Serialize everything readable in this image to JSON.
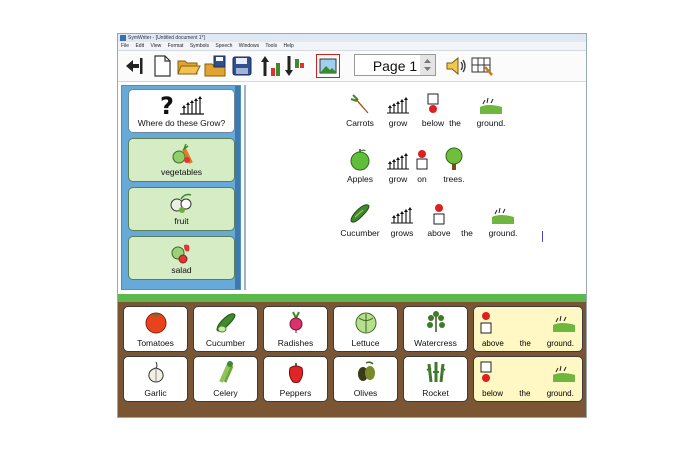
{
  "window": {
    "title": "SymWriter - [Untitled document 1*]"
  },
  "menu": [
    "File",
    "Edit",
    "View",
    "Format",
    "Symbols",
    "Speech",
    "Windows",
    "Tools",
    "Help"
  ],
  "toolbar": {
    "page_label": "Page 1",
    "buttons": [
      "back-icon",
      "new-document-icon",
      "open-folder-icon",
      "save-to-folder-icon",
      "save-disk-icon",
      "sort-ascending-icon",
      "sort-descending-icon",
      "picture-icon",
      "speaker-icon",
      "grid-edit-icon"
    ]
  },
  "left_grid": [
    {
      "label": "Where do these Grow?",
      "symbol": "question-mark-grow"
    },
    {
      "label": "vegetables",
      "symbol": "vegetables-icon"
    },
    {
      "label": "fruit",
      "symbol": "fruit-icon"
    },
    {
      "label": "salad",
      "symbol": "salad-icon"
    }
  ],
  "document": {
    "sentences": [
      {
        "words": [
          "Carrots",
          "grow",
          "below",
          "the",
          "ground."
        ]
      },
      {
        "words": [
          "Apples",
          "grow",
          "on",
          "trees."
        ]
      },
      {
        "words": [
          "Cucumber",
          "grows",
          "above",
          "the",
          "ground."
        ]
      }
    ]
  },
  "bottom_grid": {
    "row1": [
      "Tomatoes",
      "Cucumber",
      "Radishes",
      "Lettuce",
      "Watercress"
    ],
    "row2": [
      "Garlic",
      "Celery",
      "Peppers",
      "Olives",
      "Rocket"
    ],
    "phrase1": [
      "above",
      "the",
      "ground."
    ],
    "phrase2": [
      "below",
      "the",
      "ground."
    ]
  },
  "colors": {
    "panel_blue": "#67aada",
    "cell_green": "#d6ecc5",
    "soil_brown": "#7a5635",
    "grass_green": "#5db84d",
    "phrase_yellow": "#fff8c4"
  }
}
